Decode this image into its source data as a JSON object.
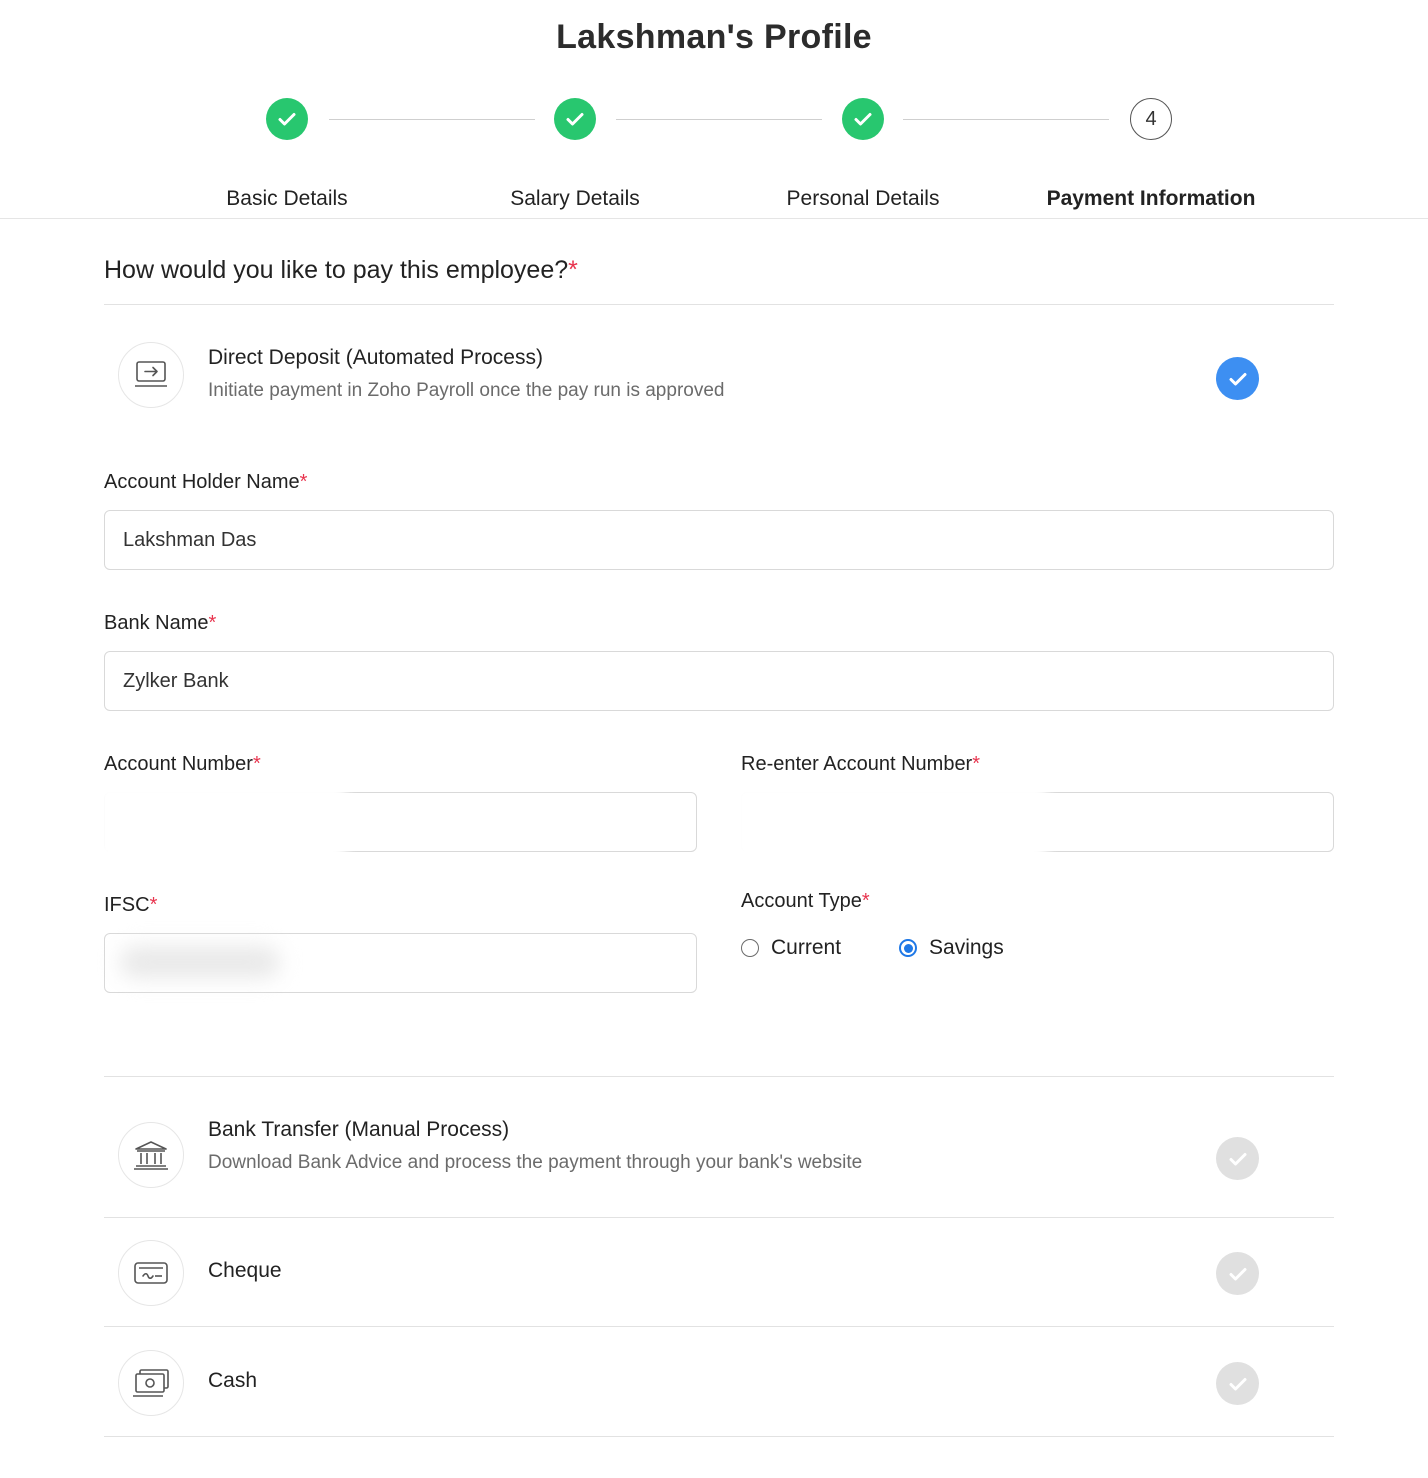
{
  "page": {
    "title": "Lakshman's Profile"
  },
  "stepper": {
    "steps": [
      {
        "label": "Basic Details",
        "status": "done"
      },
      {
        "label": "Salary Details",
        "status": "done"
      },
      {
        "label": "Personal Details",
        "status": "done"
      },
      {
        "label": "Payment Information",
        "status": "current",
        "number": "4"
      }
    ]
  },
  "form": {
    "question": "How would you like to pay this employee?",
    "required_mark": "*",
    "methods": [
      {
        "title": "Direct Deposit (Automated Process)",
        "description": "Initiate payment in Zoho Payroll once the pay run is approved",
        "icon": "transfer-screen-icon",
        "selected": true
      },
      {
        "title": "Bank Transfer (Manual Process)",
        "description": "Download Bank Advice and process the payment through your bank's website",
        "icon": "bank-icon",
        "selected": false
      },
      {
        "title": "Cheque",
        "icon": "cheque-icon",
        "selected": false
      },
      {
        "title": "Cash",
        "icon": "cash-icon",
        "selected": false
      }
    ],
    "fields": {
      "account_holder": {
        "label": "Account Holder Name",
        "value": "Lakshman Das"
      },
      "bank_name": {
        "label": "Bank Name",
        "value": "Zylker Bank"
      },
      "account_number": {
        "label": "Account Number",
        "value": ""
      },
      "reenter_account_number": {
        "label": "Re-enter Account Number",
        "value": ""
      },
      "ifsc": {
        "label": "IFSC",
        "value": ""
      },
      "account_type": {
        "label": "Account Type",
        "options": [
          "Current",
          "Savings"
        ],
        "selected": "Savings"
      }
    }
  },
  "colors": {
    "success": "#28c76f",
    "selected_check": "#3d8ff2",
    "required": "#e8344e",
    "radio_active": "#1f78e6"
  }
}
